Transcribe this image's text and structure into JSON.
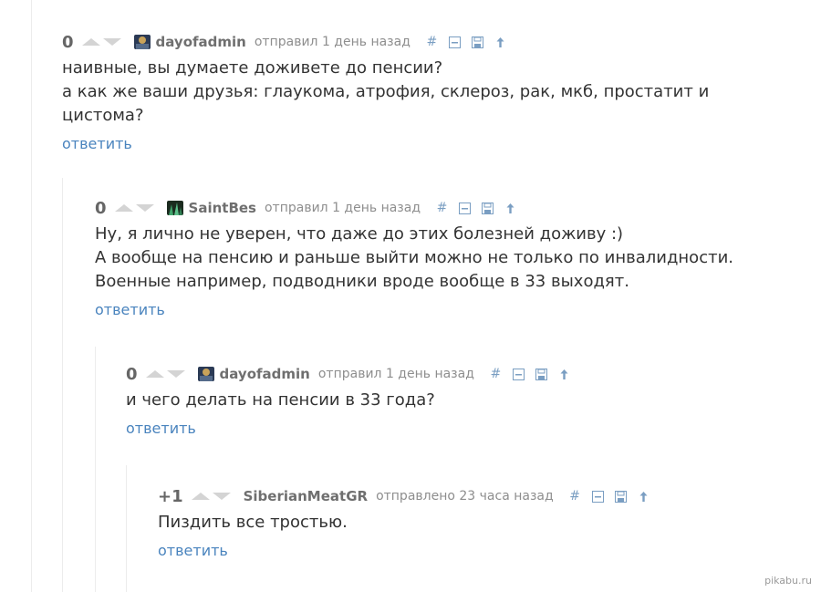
{
  "comments": [
    {
      "rating": "0",
      "author": "dayofadmin",
      "posted": "отправил 1 день назад",
      "text": "наивные, вы думаете доживете до пенсии?\nа как же ваши друзья: глаукома, атрофия, склероз, рак, мкб, простатит и\nцистома?",
      "reply": "ответить"
    },
    {
      "rating": "0",
      "author": "SaintBes",
      "posted": "отправил 1 день назад",
      "text": "Ну, я лично не уверен, что даже до этих болезней доживу :)\nА вообще на пенсию и раньше выйти можно не только по инвалидности.\nВоенные например, подводники вроде вообще в 33 выходят.",
      "reply": "ответить"
    },
    {
      "rating": "0",
      "author": "dayofadmin",
      "posted": "отправил 1 день назад",
      "text": "и чего делать на пенсии в 33 года?",
      "reply": "ответить"
    },
    {
      "rating": "+1",
      "author": "SiberianMeatGR",
      "posted": "отправлено 23 часа назад",
      "text": "Пиздить все тростью.",
      "reply": "ответить"
    }
  ],
  "icons": [
    "hash-icon",
    "collapse-icon",
    "save-icon",
    "arrow-up-icon"
  ],
  "watermark": "pikabu.ru"
}
